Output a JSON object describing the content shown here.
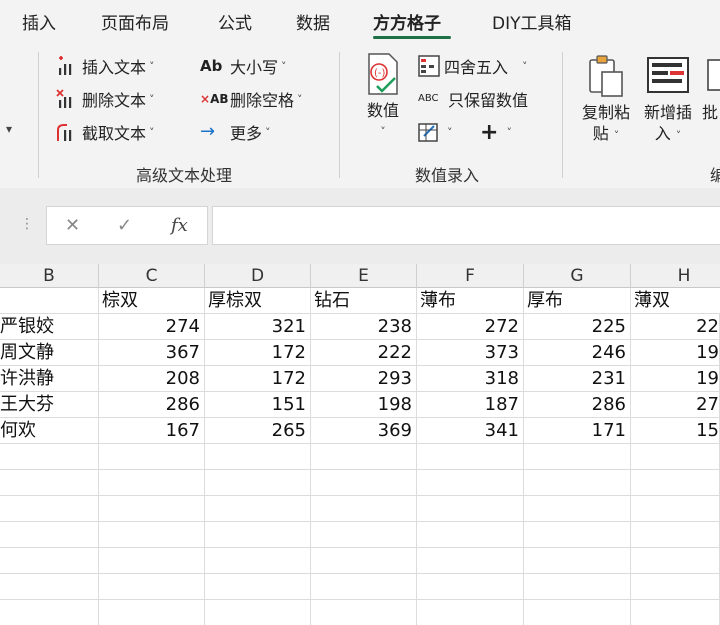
{
  "tabs": [
    {
      "label": "插入"
    },
    {
      "label": "页面布局"
    },
    {
      "label": "公式"
    },
    {
      "label": "数据"
    },
    {
      "label": "方方格子",
      "active": true
    },
    {
      "label": "DIY工具箱"
    }
  ],
  "ribbon": {
    "text_group": {
      "items": [
        {
          "label": "插入文本",
          "icon": "insert-text-icon"
        },
        {
          "label": "删除文本",
          "icon": "delete-text-icon"
        },
        {
          "label": "截取文本",
          "icon": "extract-text-icon"
        },
        {
          "label": "大小写",
          "icon": "case-icon"
        },
        {
          "label": "删除空格",
          "icon": "delete-space-icon"
        },
        {
          "label": "更多",
          "icon": "more-arrow-icon"
        }
      ],
      "group_label": "高级文本处理"
    },
    "number_group": {
      "big_button": {
        "line1": "数值",
        "icon": "number-value-icon"
      },
      "items": [
        {
          "label": "四舍五入",
          "icon": "round-icon"
        },
        {
          "label": "只保留数值",
          "icon": "keep-number-icon"
        }
      ],
      "group_label": "数值录入"
    },
    "right_buttons": [
      {
        "line1": "复制粘",
        "line2": "贴",
        "icon": "copy-paste-icon"
      },
      {
        "line1": "新增插",
        "line2": "入",
        "icon": "new-insert-icon"
      },
      {
        "line1": "批",
        "line2": "",
        "icon": "batch-icon"
      }
    ],
    "partial_group_label": "编"
  },
  "formula_bar": {
    "cancel_symbol": "✕",
    "confirm_symbol": "✓",
    "fx_symbol": "fx",
    "value": ""
  },
  "sheet": {
    "columns": [
      "B",
      "C",
      "D",
      "E",
      "F",
      "G",
      "H"
    ],
    "header_row": [
      "",
      "棕双",
      "厚棕双",
      "钻石",
      "薄布",
      "厚布",
      "薄双"
    ],
    "data_rows": [
      [
        "严银姣",
        "274",
        "321",
        "238",
        "272",
        "225",
        "22"
      ],
      [
        "周文静",
        "367",
        "172",
        "222",
        "373",
        "246",
        "19"
      ],
      [
        "许洪静",
        "208",
        "172",
        "293",
        "318",
        "231",
        "19"
      ],
      [
        "王大芬",
        "286",
        "151",
        "198",
        "187",
        "286",
        "27"
      ],
      [
        "何欢",
        "167",
        "265",
        "369",
        "341",
        "171",
        "15"
      ]
    ]
  }
}
